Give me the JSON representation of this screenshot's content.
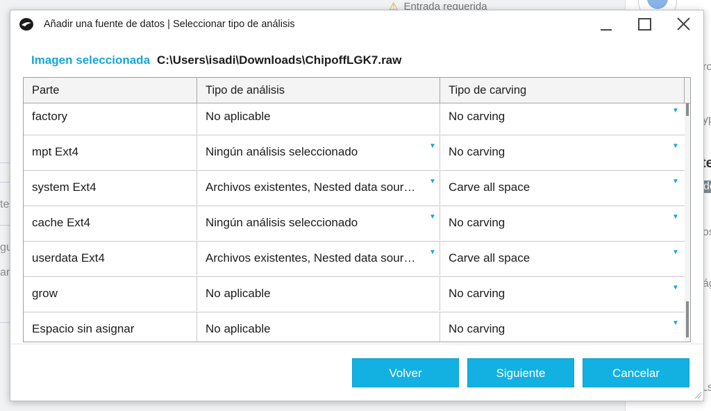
{
  "background": {
    "notice": "Entrada requerida",
    "fragments": [
      "ro",
      "yp",
      "te",
      "de",
      "os",
      "ág",
      "Ls",
      "te",
      "gu",
      "ar"
    ]
  },
  "dialog": {
    "title": "Añadir una fuente de datos | Seleccionar tipo de análisis",
    "image_label": "Imagen seleccionada",
    "image_path": "C:\\Users\\isadi\\Downloads\\ChipoffLGK7.raw",
    "columns": [
      "Parte",
      "Tipo de análisis",
      "Tipo de carving"
    ],
    "rows": [
      {
        "parte": "factory",
        "analisis": "No aplicable",
        "carving": "No carving",
        "analisis_dropdown": false
      },
      {
        "parte": "mpt Ext4",
        "analisis": "Ningún análisis seleccionado",
        "carving": "No carving",
        "analisis_dropdown": true
      },
      {
        "parte": "system Ext4",
        "analisis": "Archivos existentes, Nested data sourc...",
        "carving": "Carve all space",
        "analisis_dropdown": true
      },
      {
        "parte": "cache Ext4",
        "analisis": "Ningún análisis seleccionado",
        "carving": "No carving",
        "analisis_dropdown": true
      },
      {
        "parte": "userdata Ext4",
        "analisis": "Archivos existentes, Nested data sourc...",
        "carving": "Carve all space",
        "analisis_dropdown": true
      },
      {
        "parte": "grow",
        "analisis": "No aplicable",
        "carving": "No carving",
        "analisis_dropdown": false
      },
      {
        "parte": "Espacio sin asignar",
        "analisis": "No aplicable",
        "carving": "No carving",
        "analisis_dropdown": false
      }
    ],
    "buttons": {
      "back": "Volver",
      "next": "Siguiente",
      "cancel": "Cancelar"
    },
    "icons": {
      "app": "app-logo-icon",
      "dropdown": "chevron-down-icon",
      "minimize": "minimize-icon",
      "maximize": "maximize-icon",
      "close": "close-icon"
    },
    "colors": {
      "accent": "#13b0e2",
      "label": "#19a6d6"
    }
  }
}
